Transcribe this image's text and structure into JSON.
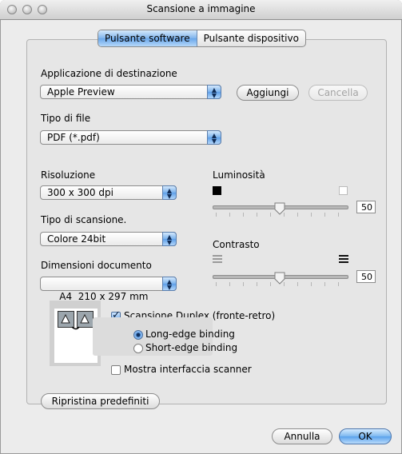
{
  "window": {
    "title": "Scansione a immagine"
  },
  "tabs": [
    {
      "label": "Pulsante software",
      "selected": true
    },
    {
      "label": "Pulsante dispositivo",
      "selected": false
    }
  ],
  "destination": {
    "label": "Applicazione di destinazione",
    "selected": "Apple Preview",
    "add_label": "Aggiungi",
    "delete_label": "Cancella"
  },
  "file_type": {
    "label": "Tipo di file",
    "selected": "PDF (*.pdf)"
  },
  "resolution": {
    "label": "Risoluzione",
    "selected": "300 x 300 dpi"
  },
  "scan_type": {
    "label": "Tipo di scansione.",
    "selected": "Colore 24bit"
  },
  "doc_size": {
    "label": "Dimensioni documento",
    "selected": "A4  210 x 297 mm"
  },
  "brightness": {
    "label": "Luminosità",
    "value": "50",
    "level": 0.5
  },
  "contrast": {
    "label": "Contrasto",
    "value": "50",
    "level": 0.5
  },
  "duplex": {
    "label": "Scansione Duplex (fronte-retro)",
    "checked": true,
    "long_edge": "Long-edge binding",
    "short_edge": "Short-edge binding",
    "selected": "long"
  },
  "scanner_interface": {
    "label": "Mostra interfaccia scanner",
    "checked": false
  },
  "buttons": {
    "reset": "Ripristina predefiniti",
    "cancel": "Annulla",
    "ok": "OK"
  },
  "colors": {
    "accent": "#6aa6ea",
    "panel": "#e6e6e6"
  }
}
